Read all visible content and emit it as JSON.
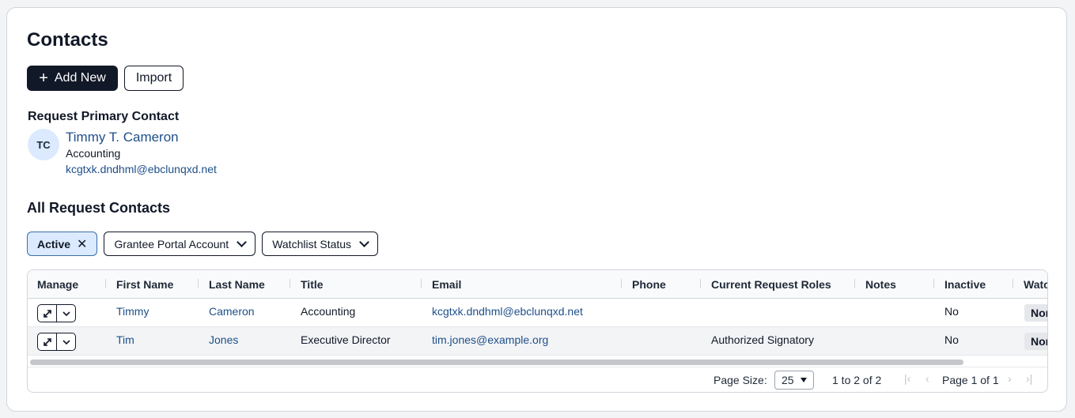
{
  "page": {
    "title": "Contacts"
  },
  "toolbar": {
    "add_label": "Add New",
    "import_label": "Import"
  },
  "primary": {
    "heading": "Request Primary Contact",
    "initials": "TC",
    "name": "Timmy T. Cameron",
    "title": "Accounting",
    "email": "kcgtxk.dndhml@ebclunqxd.net"
  },
  "all_contacts": {
    "heading": "All Request Contacts"
  },
  "filters": {
    "active": "Active",
    "portal": "Grantee Portal Account",
    "watchlist": "Watchlist Status"
  },
  "columns": [
    "Manage",
    "First Name",
    "Last Name",
    "Title",
    "Email",
    "Phone",
    "Current Request Roles",
    "Notes",
    "Inactive",
    "Watc"
  ],
  "rows": [
    {
      "first": "Timmy",
      "last": "Cameron",
      "title": "Accounting",
      "email": "kcgtxk.dndhml@ebclunqxd.net",
      "phone": "",
      "roles": "",
      "notes": "",
      "inactive": "No",
      "watch": "Nor"
    },
    {
      "first": "Tim",
      "last": "Jones",
      "title": "Executive Director",
      "email": "tim.jones@example.org",
      "phone": "",
      "roles": "Authorized Signatory",
      "notes": "",
      "inactive": "No",
      "watch": "Nor"
    }
  ],
  "pagination": {
    "page_size_label": "Page Size:",
    "page_size": "25",
    "range": "1 to 2 of 2",
    "page_label": "Page 1 of 1"
  },
  "colors": {
    "primary_dark": "#111827",
    "link": "#1e4f8a",
    "active_chip": "#dbeafe"
  }
}
